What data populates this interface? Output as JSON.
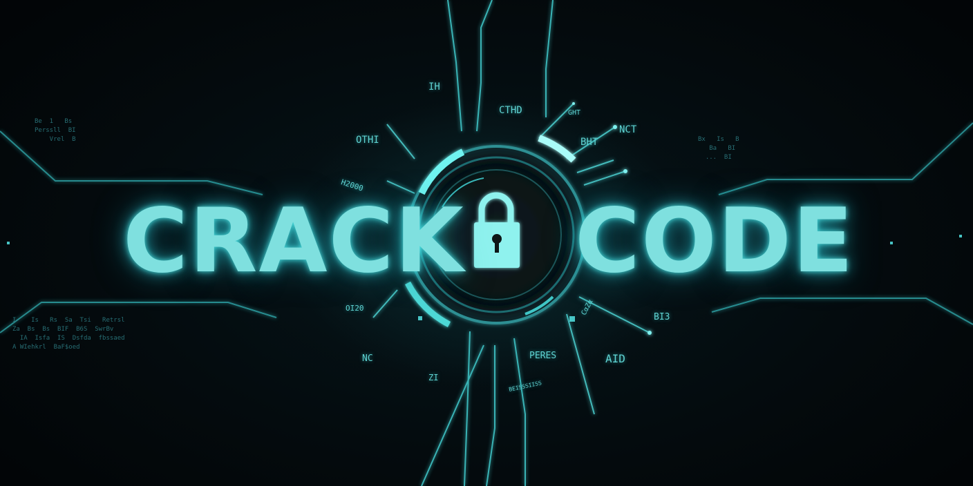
{
  "title": {
    "left_word": "CRACK",
    "right_word": "CODE"
  },
  "ring_labels": {
    "ih": "IH",
    "cthd": "CTHD",
    "oth": "OTHI",
    "bht": "BHT",
    "nct": "NCT",
    "ght": "GHT",
    "h2000": "H2000",
    "oi20": "OI20",
    "nc": "NC",
    "z1": "ZI",
    "peres": "PERES",
    "aid": "AID",
    "bi3": "BI3",
    "c_rot": "CαZα",
    "bottom_small": "BEISSSIISS"
  },
  "code_left_top": [
    "Be  1   Bs",
    "Perssll  BI",
    "    Vrel  B"
  ],
  "code_left_bottom": [
    "I    Is   Rs  Sa  Tsi   Retrsl",
    "Za  Bs  Bs  BIF  B6S  SwrBv",
    "  IA  Isfa  IS  Dsfda  fbssaed",
    "A WIehkrl  BaF$oed"
  ],
  "code_right_top": [
    "Bx   Is   B",
    "   Ba   BI",
    "  ...  BI"
  ],
  "colors": {
    "accent": "#7fe0df",
    "glow": "#3fd0d0",
    "background": "#04090c"
  },
  "icons": {
    "center": "padlock-icon"
  }
}
